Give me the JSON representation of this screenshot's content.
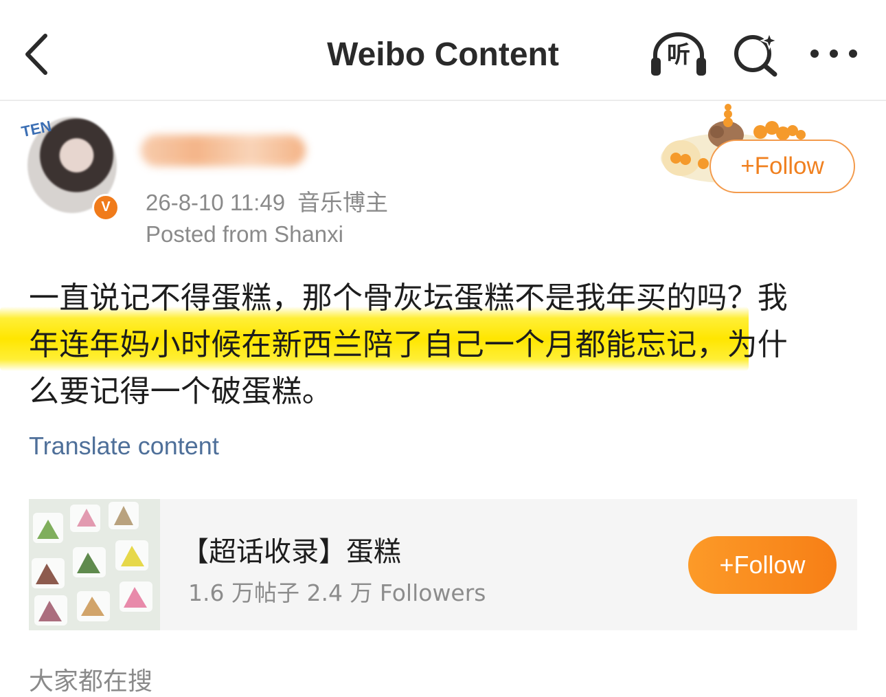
{
  "header": {
    "title": "Weibo Content",
    "listen_label": "听",
    "icons": [
      "back-chevron-icon",
      "headphones-icon",
      "ai-search-icon",
      "more-dots-icon"
    ]
  },
  "author": {
    "time": "26-8-10 11:49",
    "tag": "音乐博主",
    "location": "Posted from Shanxi",
    "verified_badge": "V",
    "avatar_logo_text": "TEN",
    "follow_label": "+Follow"
  },
  "post": {
    "line1": "一直说记不得蛋糕，那个骨灰坛蛋糕不是我年买的吗？我",
    "line2_highlight": "年连年妈小时候在新西兰陪了自己一个月都能忘记",
    "line2_rest": "，为什",
    "line3": "么要记得一个破蛋糕。",
    "translate_label": "Translate content",
    "highlight_color": "#ffe600"
  },
  "topic_card": {
    "title": "【超话收录】蛋糕",
    "stats": "1.6 万帖子 2.4 万 Followers",
    "follow_label": "+Follow",
    "accent": "#f7851a"
  },
  "footer": {
    "section_label": "大家都在搜"
  },
  "colors": {
    "accent_orange": "#f0801f",
    "link_blue": "#4e6f99",
    "muted_text": "#8a8a8a"
  }
}
